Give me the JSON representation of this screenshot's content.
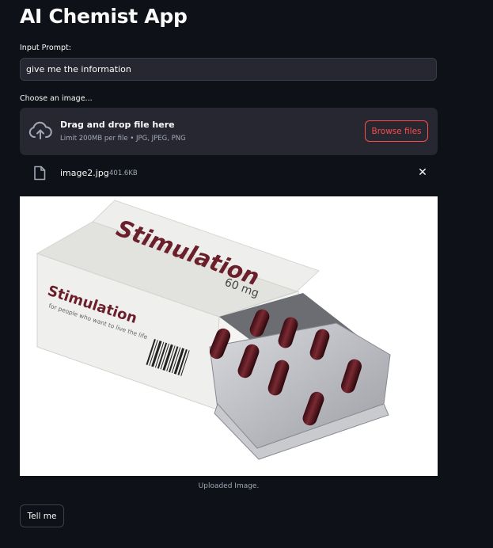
{
  "app": {
    "title": "AI Chemist App"
  },
  "prompt": {
    "label": "Input Prompt:",
    "value": "give me the information"
  },
  "uploader": {
    "label": "Choose an image...",
    "drop_title": "Drag and drop file here",
    "drop_subtitle": "Limit 200MB per file • JPG, JPEG, PNG",
    "browse_label": "Browse files",
    "icon": "cloud-upload-icon"
  },
  "uploaded_file": {
    "name": "image2.jpg",
    "size": "401.6KB",
    "icon": "file-icon",
    "remove_icon": "close-icon",
    "remove_glyph": "✕"
  },
  "image": {
    "box_label_large": "Stimulation",
    "box_dose": "60 mg",
    "box_label_front": "Stimulation",
    "box_tagline": "for people who want to live the life",
    "caption": "Uploaded Image."
  },
  "actions": {
    "submit_label": "Tell me"
  },
  "colors": {
    "background": "#0e1117",
    "widget": "#262730",
    "accent": "#ff4b4b",
    "muted_text": "#a3a8b8",
    "capsule": "#5a1a22"
  }
}
